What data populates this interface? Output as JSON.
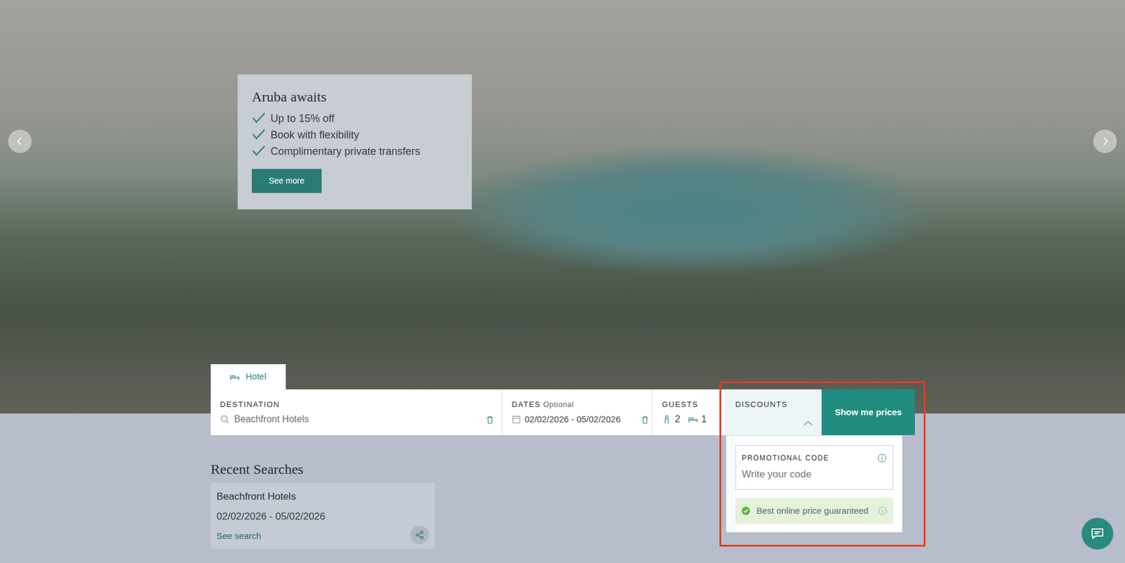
{
  "promo": {
    "title": "Aruba awaits",
    "items": [
      "Up to 15% off",
      "Book with flexibility",
      "Complimentary private transfers"
    ],
    "button": "See more"
  },
  "search_tabs": [
    {
      "label": "Hotel",
      "selected": true
    }
  ],
  "search": {
    "destination": {
      "label": "DESTINATION",
      "value": "Beachfront Hotels"
    },
    "dates": {
      "label": "DATES",
      "optional": "Optional",
      "value": "02/02/2026 - 05/02/2026"
    },
    "guests": {
      "label": "GUESTS",
      "adults": "2",
      "rooms": "1"
    },
    "discounts": {
      "label": "DISCOUNTS",
      "expanded": true
    },
    "submit": "Show me prices"
  },
  "discounts_panel": {
    "promo_label": "PROMOTIONAL CODE",
    "promo_placeholder": "Write your code",
    "guarantee": "Best online price guaranteed"
  },
  "recent": {
    "title": "Recent Searches",
    "items": [
      {
        "name": "Beachfront Hotels",
        "dates": "02/02/2026 - 05/02/2026",
        "link": "See search"
      }
    ]
  }
}
